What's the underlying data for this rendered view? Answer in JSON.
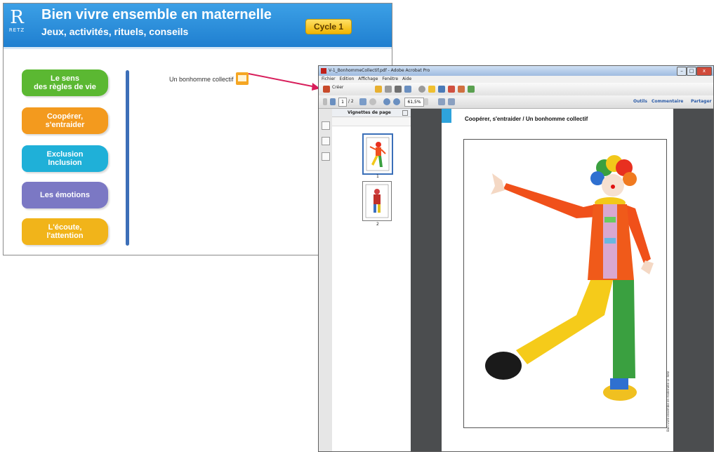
{
  "app": {
    "logo_letter": "R",
    "logo_text": "RETZ",
    "title": "Bien vivre ensemble en maternelle",
    "subtitle": "Jeux, activités, rituels, conseils",
    "cycle": "Cycle 1",
    "menu": [
      {
        "label": "Le sens\ndes règles de vie",
        "color": "#5bb832"
      },
      {
        "label": "Coopérer,\ns'entraider",
        "color": "#f39a1e"
      },
      {
        "label": "Exclusion\nInclusion",
        "color": "#1fb0d8"
      },
      {
        "label": "Les émotions",
        "color": "#7b78c4"
      },
      {
        "label": "L'écoute,\nl'attention",
        "color": "#f1b41a"
      }
    ],
    "document_link": "Un bonhomme collectif"
  },
  "acrobat": {
    "title": "V-1_BonhommeCollectif.pdf - Adobe Acrobat Pro",
    "menu": [
      "Fichier",
      "Edition",
      "Affichage",
      "Fenêtre",
      "Aide"
    ],
    "create_label": "Créer",
    "page_current": "1",
    "page_total": "/ 2",
    "zoom": "61,5%",
    "links": [
      "Outils",
      "Commentaire",
      "Partager"
    ],
    "thumbnails_title": "Vignettes de page",
    "thumb_numbers": [
      "1",
      "2"
    ],
    "page_heading": "Coopérer, s'entraider / Un bonhomme collectif",
    "page_side_text": "Bien vivre ensemble en maternelle © Retz"
  },
  "colors": {
    "header_blue": "#1f7fd0",
    "arrow": "#d81e5b",
    "acrobat_dark": "#4b4d4f"
  }
}
